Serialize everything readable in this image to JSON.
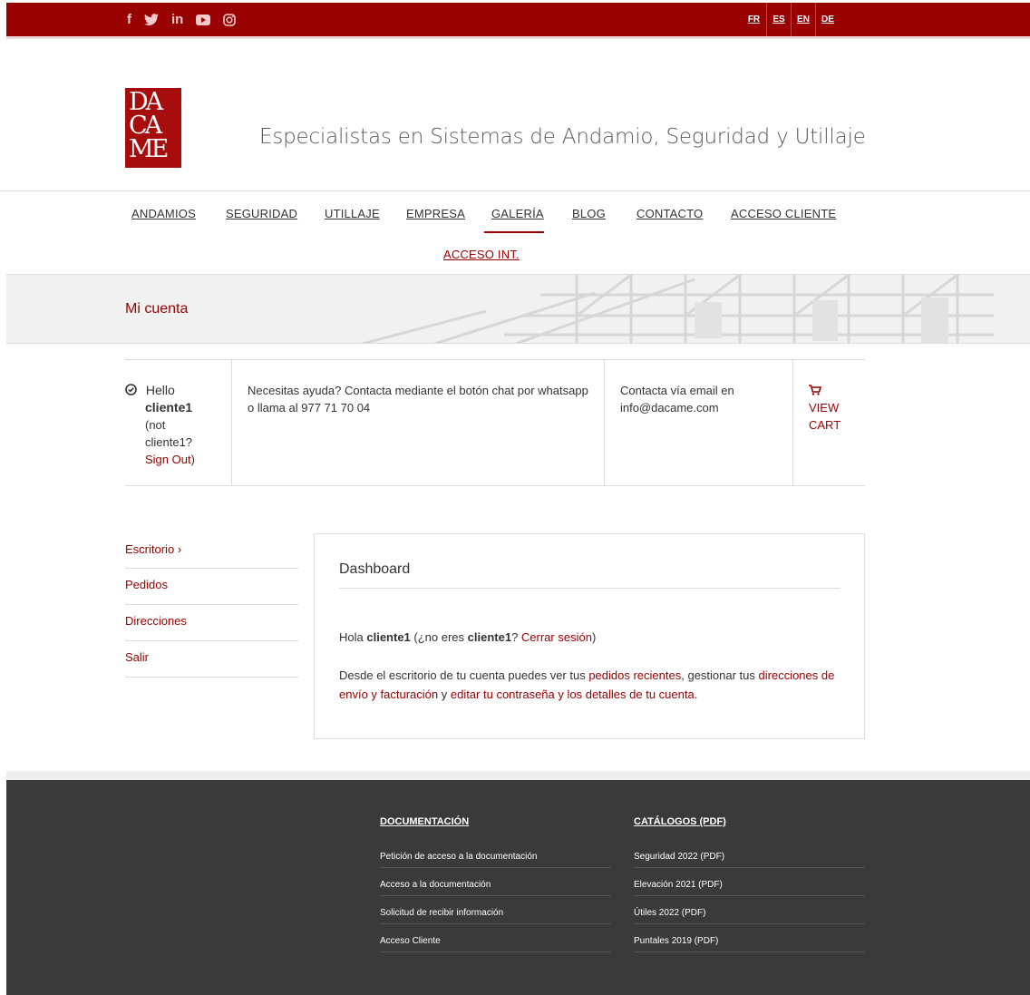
{
  "topbar": {
    "social": [
      "facebook-icon",
      "twitter-icon",
      "linkedin-icon",
      "youtube-icon",
      "instagram-icon"
    ],
    "languages": [
      "FR",
      "ES",
      "EN",
      "DE"
    ]
  },
  "brand": {
    "logo_lines": [
      "DA",
      "CA",
      "ME"
    ],
    "tagline": "Especialistas en Sistemas de Andamio, Seguridad y Utillaje"
  },
  "nav": {
    "items": [
      "ANDAMIOS",
      "SEGURIDAD",
      "UTILLAJE",
      "EMPRESA",
      "GALERÍA",
      "BLOG",
      "CONTACTO",
      "ACCESO CLIENTE",
      "ACCESO INT."
    ]
  },
  "hero": {
    "title": "Mi cuenta"
  },
  "account": {
    "hello": "Hello",
    "username": "cliente1",
    "not_user": "(not cliente1?",
    "sign_out": "Sign Out",
    "sign_out_close": ")",
    "help_text": "Necesitas ayuda? Contacta mediante el botón chat por whatsapp o llama al 977 71 70 04",
    "email_text": "Contacta vía email en info@dacame.com",
    "cart_label": "VIEW CART"
  },
  "sidemenu": {
    "items": [
      "Escritorio",
      "Pedidos",
      "Direcciones",
      "Salir"
    ],
    "active_marker": "›"
  },
  "dashboard": {
    "title": "Dashboard",
    "greeting_prefix": "Hola ",
    "greeting_user": "cliente1",
    "greeting_mid": " (¿no eres ",
    "greeting_user2": "cliente1",
    "greeting_q": "? ",
    "logout_link": "Cerrar sesión",
    "greeting_end": ")",
    "desc_1": "Desde el escritorio de tu cuenta puedes ver tus ",
    "link_orders": "pedidos recientes",
    "desc_2": ", gestionar tus ",
    "link_addresses": "direcciones de envío y facturación",
    "desc_3": " y ",
    "link_account": "editar tu contraseña y los detalles de tu cuenta",
    "desc_4": "."
  },
  "footer": {
    "col1": {
      "heading": "DOCUMENTACIÓN",
      "links": [
        "Petición de acceso a la documentación",
        "Acceso a la documentación",
        "Solicitud de recibir información",
        "Acceso Cliente"
      ]
    },
    "col2": {
      "heading": "CATÁLOGOS (PDF)",
      "links": [
        "Seguridad 2022 (PDF)",
        "Elevación 2021 (PDF)",
        "Útiles 2022 (PDF)",
        "Puntales 2019 (PDF)"
      ]
    }
  },
  "colors": {
    "brand_red": "#990000",
    "footer_bg": "#3a3a3a"
  }
}
